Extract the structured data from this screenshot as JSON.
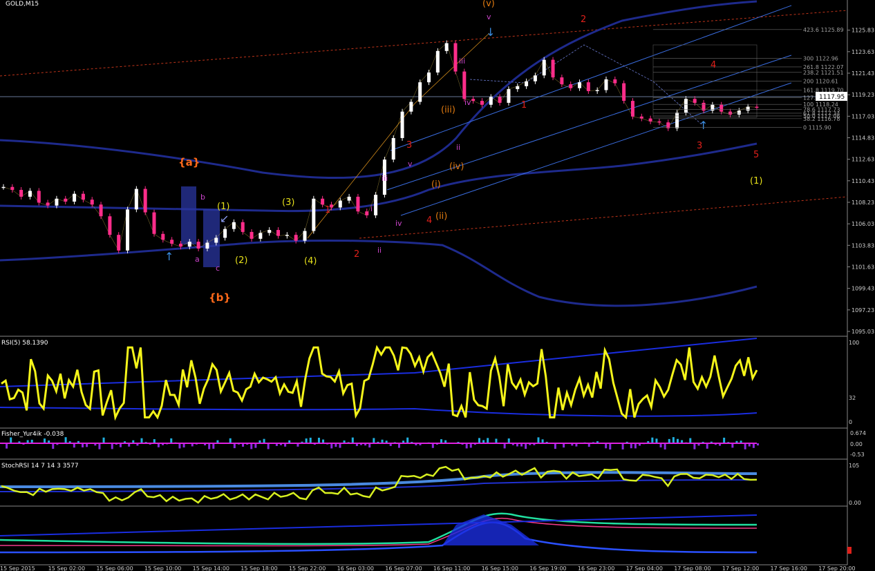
{
  "chart_data": {
    "type": "line",
    "title": "GOLD,M15",
    "symbol": "GOLD",
    "timeframe": "M15",
    "price_axis": {
      "range": [
        1095.03,
        1127.5
      ],
      "ticks": [
        "1125.83",
        "1123.63",
        "1121.43",
        "1119.23",
        "1117.03",
        "1114.83",
        "1112.63",
        "1110.43",
        "1108.23",
        "1106.03",
        "1103.83",
        "1101.63",
        "1099.43",
        "1097.23",
        "1095.03"
      ],
      "current_price": "1117.95"
    },
    "time_axis": [
      "15 Sep 2015",
      "15 Sep 02:00",
      "15 Sep 06:00",
      "15 Sep 10:00",
      "15 Sep 14:00",
      "15 Sep 18:00",
      "15 Sep 22:00",
      "16 Sep 03:00",
      "16 Sep 07:00",
      "16 Sep 11:00",
      "16 Sep 15:00",
      "16 Sep 19:00",
      "16 Sep 23:00",
      "17 Sep 04:00",
      "17 Sep 08:00",
      "17 Sep 12:00",
      "17 Sep 16:00",
      "17 Sep 20:00"
    ],
    "series": [
      {
        "values": [
          1109.8,
          1109.5,
          1108.8,
          1109.4,
          1108.2,
          1107.9,
          1108.6,
          1108.3,
          1109.1,
          1108.5,
          1108.0,
          1106.8,
          1104.9,
          1103.3,
          1107.5,
          1109.6,
          1107.2,
          1105.0,
          1104.4,
          1104.0,
          1103.7,
          1104.2,
          1103.5,
          1104.1,
          1104.6,
          1105.5,
          1106.2,
          1105.2,
          1104.5,
          1105.1,
          1105.4,
          1104.8,
          1104.9,
          1104.3,
          1105.3,
          1108.6,
          1108.0,
          1107.7,
          1108.4,
          1108.8,
          1107.3,
          1106.9,
          1109.0,
          1112.6,
          1114.8,
          1117.5,
          1118.5,
          1120.5,
          1121.5,
          1123.7,
          1124.5,
          1121.6,
          1118.8,
          1118.6,
          1118.2,
          1119.0,
          1118.4,
          1119.8,
          1120.1,
          1120.6,
          1121.2,
          1122.8,
          1121.0,
          1120.3,
          1119.9,
          1120.5,
          1119.6,
          1119.7,
          1120.8,
          1120.4,
          1118.6,
          1117.0,
          1116.8,
          1116.5,
          1116.4,
          1115.8,
          1117.4,
          1118.8,
          1118.4,
          1117.6,
          1118.2,
          1117.5,
          1117.2,
          1117.6,
          1118.0,
          1117.95
        ]
      }
    ],
    "fib_levels": [
      {
        "label": "423.6 1125.89"
      },
      {
        "label": "300 1122.96"
      },
      {
        "label": "261.8 1122.07"
      },
      {
        "label": "238.2 1121.51"
      },
      {
        "label": "200 1120.61"
      },
      {
        "label": "161.8 1119.70"
      },
      {
        "label": "127.2 1118.92"
      },
      {
        "label": "100 1118.24"
      },
      {
        "label": "78.6 1117.73"
      },
      {
        "label": "61.8 1117.34"
      },
      {
        "label": "50.0 1117.06"
      },
      {
        "label": "38.2 1116.78"
      },
      {
        "label": "0 1115.90"
      }
    ],
    "wave_labels": [
      {
        "text": "{a}",
        "color": "#ff6a1a"
      },
      {
        "text": "{b}",
        "color": "#ff6a1a"
      },
      {
        "text": "(1)",
        "color": "#e6e01a"
      },
      {
        "text": "(2)",
        "color": "#e6e01a"
      },
      {
        "text": "(3)",
        "color": "#e6e01a"
      },
      {
        "text": "(4)",
        "color": "#e6e01a"
      },
      {
        "text": "(1)",
        "color": "#e6e01a"
      },
      {
        "text": "1",
        "color": "#e0201a"
      },
      {
        "text": "2",
        "color": "#e0201a"
      },
      {
        "text": "3",
        "color": "#e0201a"
      },
      {
        "text": "4",
        "color": "#e0201a"
      },
      {
        "text": "1",
        "color": "#e0201a"
      },
      {
        "text": "2",
        "color": "#e0201a"
      },
      {
        "text": "3",
        "color": "#e0201a"
      },
      {
        "text": "4",
        "color": "#e0201a"
      },
      {
        "text": "5",
        "color": "#e0201a"
      },
      {
        "text": "a",
        "color": "#cc44cc"
      },
      {
        "text": "b",
        "color": "#cc44cc"
      },
      {
        "text": "c",
        "color": "#cc44cc"
      },
      {
        "text": "i",
        "color": "#cc44cc"
      },
      {
        "text": "ii",
        "color": "#cc44cc"
      },
      {
        "text": "iii",
        "color": "#cc44cc"
      },
      {
        "text": "iv",
        "color": "#cc44cc"
      },
      {
        "text": "v",
        "color": "#cc44cc"
      },
      {
        "text": "iii",
        "color": "#cc44cc"
      },
      {
        "text": "iv",
        "color": "#cc44cc"
      },
      {
        "text": "ii",
        "color": "#cc44cc"
      },
      {
        "text": "v",
        "color": "#cc44cc"
      },
      {
        "text": "(i)",
        "color": "#e07a10"
      },
      {
        "text": "(ii)",
        "color": "#e07a10"
      },
      {
        "text": "(iii)",
        "color": "#e07a10"
      },
      {
        "text": "(iv)",
        "color": "#e07a10"
      },
      {
        "text": "(v)",
        "color": "#e07a10"
      }
    ],
    "indicators": {
      "rsi": {
        "label": "RSI(5) 58.1390",
        "ticks": [
          "100",
          "32",
          "0"
        ]
      },
      "fisher": {
        "label": "Fisher_Yur4ik -0.038",
        "ticks": [
          "0.674",
          "0.00",
          "-0.53"
        ]
      },
      "stoch": {
        "label": "StochRSI 14 7 14 3 3577",
        "ticks": [
          "105",
          "0.00"
        ]
      }
    }
  },
  "colors": {
    "background": "#000000",
    "candle_up": "#ffffff",
    "candle_down": "#ff2d8a",
    "band": "#1e2a8c",
    "channel": "#3a6de0",
    "rsi": "#f5f51a",
    "fib": "#7a7a7a"
  }
}
